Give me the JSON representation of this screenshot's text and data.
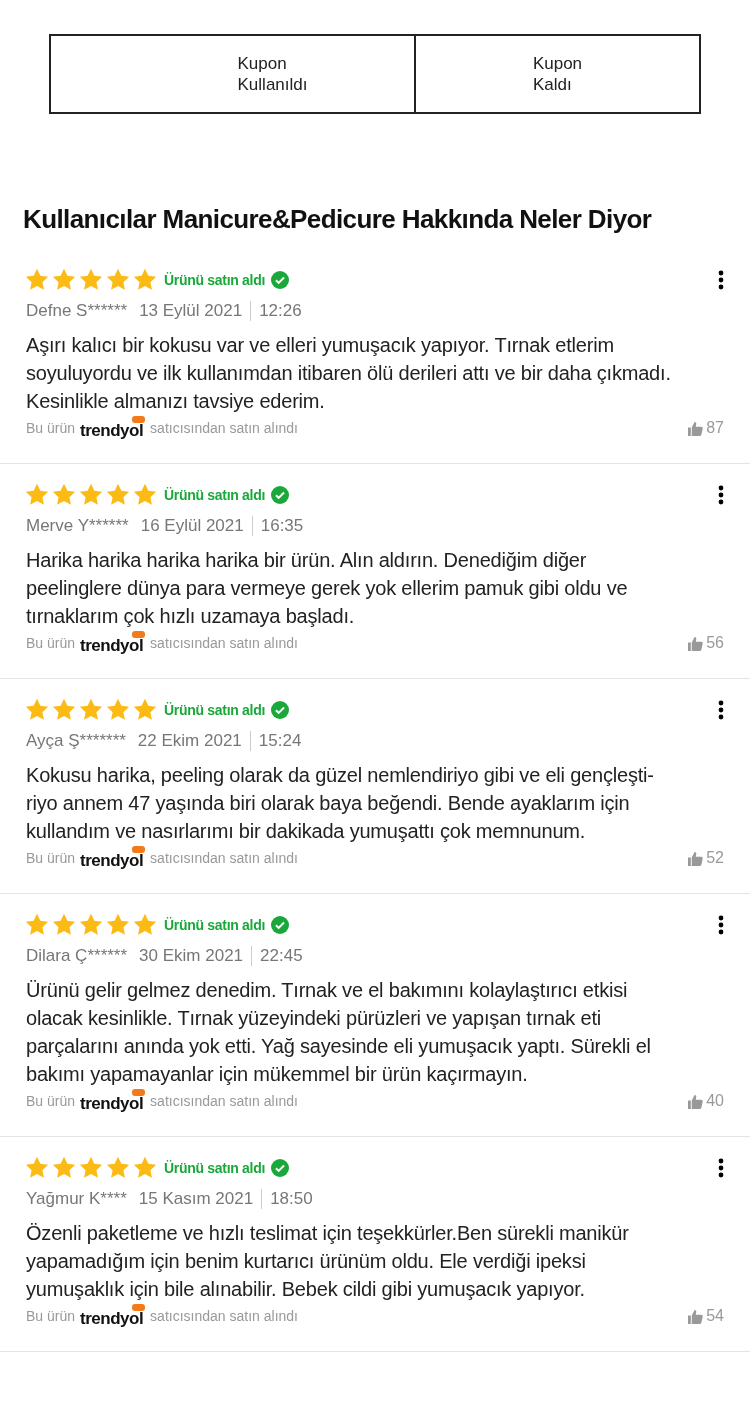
{
  "coupon_tabs": [
    {
      "lines": [
        "Kupon",
        "Kullanıldı"
      ]
    },
    {
      "lines": [
        "Kupon",
        "Kaldı"
      ]
    }
  ],
  "title": "Kullanıcılar Manicure&Pedicure Hakkında Neler Diyor",
  "reviews": [
    {
      "stars": 5,
      "verified": true,
      "badge": "Ürünü satın aldı",
      "author": "Defne S******",
      "date": "13 Eylül 2021",
      "time": "12:26",
      "text": "Aşırı kalıcı bir kokusu var ve elleri yumuşacık yapıyor. Tırnak etlerim soyuluyordu ve ilk kullanımdan itibaren ölü derileri attı ve bir daha çıkmadı. Kesinlikle almanızı tavsiye ederim.",
      "seller_prefix": "Bu ürün",
      "seller": "trendyol",
      "seller_suffix": "satıcısından satın alındı",
      "likes": "87"
    },
    {
      "stars": 5,
      "verified": true,
      "badge": "Ürünü satın aldı",
      "author": "Merve Y******",
      "date": "16 Eylül 2021",
      "time": "16:35",
      "text": "Harika harika harika harika bir ürün. Alın aldırın. Denediğim diğer peelinglere dünya para vermeye gerek yok ellerim pamuk gibi oldu ve tırnaklarım çok hızlı uzamaya başladı.",
      "seller_prefix": "Bu ürün",
      "seller": "trendyol",
      "seller_suffix": "satıcısından satın alındı",
      "likes": "56"
    },
    {
      "stars": 5,
      "verified": true,
      "badge": "Ürünü satın aldı",
      "author": "Ayça Ş*******",
      "date": "22 Ekim 2021",
      "time": "15:24",
      "text": "Kokusu harika, peeling olarak da güzel nemlendiriyo gibi ve eli gençleşti-riyo annem 47 yaşında biri olarak baya beğendi. Bende ayaklarım için kullandım ve nasırlarımı bir dakikada yumuşattı çok memnunum.",
      "seller_prefix": "Bu ürün",
      "seller": "trendyol",
      "seller_suffix": "satıcısından satın alındı",
      "likes": "52"
    },
    {
      "stars": 5,
      "verified": true,
      "badge": "Ürünü satın aldı",
      "author": "Dilara Ç******",
      "date": "30 Ekim 2021",
      "time": "22:45",
      "text": "Ürünü gelir gelmez denedim. Tırnak ve el bakımını kolaylaştırıcı etkisi olacak kesinlikle. Tırnak yüzeyindeki pürüzleri ve yapışan tırnak eti parçalarını anında yok etti. Yağ sayesinde eli yumuşacık yaptı. Sürekli el bakımı yapamayanlar için mükemmel bir ürün kaçırmayın.",
      "seller_prefix": "Bu ürün",
      "seller": "trendyol",
      "seller_suffix": "satıcısından satın alındı",
      "likes": "40"
    },
    {
      "stars": 5,
      "verified": true,
      "badge": "Ürünü satın aldı",
      "author": "Yağmur K****",
      "date": "15 Kasım 2021",
      "time": "18:50",
      "text": "Özenli paketleme ve hızlı teslimat için teşekkürler.Ben sürekli manikür yapamadığım için benim kurtarıcı ürünüm oldu. Ele verdiği ipeksi yumuşaklık için bile alınabilir. Bebek cildi gibi yumuşacık yapıyor.",
      "seller_prefix": "Bu ürün",
      "seller": "trendyol",
      "seller_suffix": "satıcısından satın alındı",
      "likes": "54"
    }
  ]
}
